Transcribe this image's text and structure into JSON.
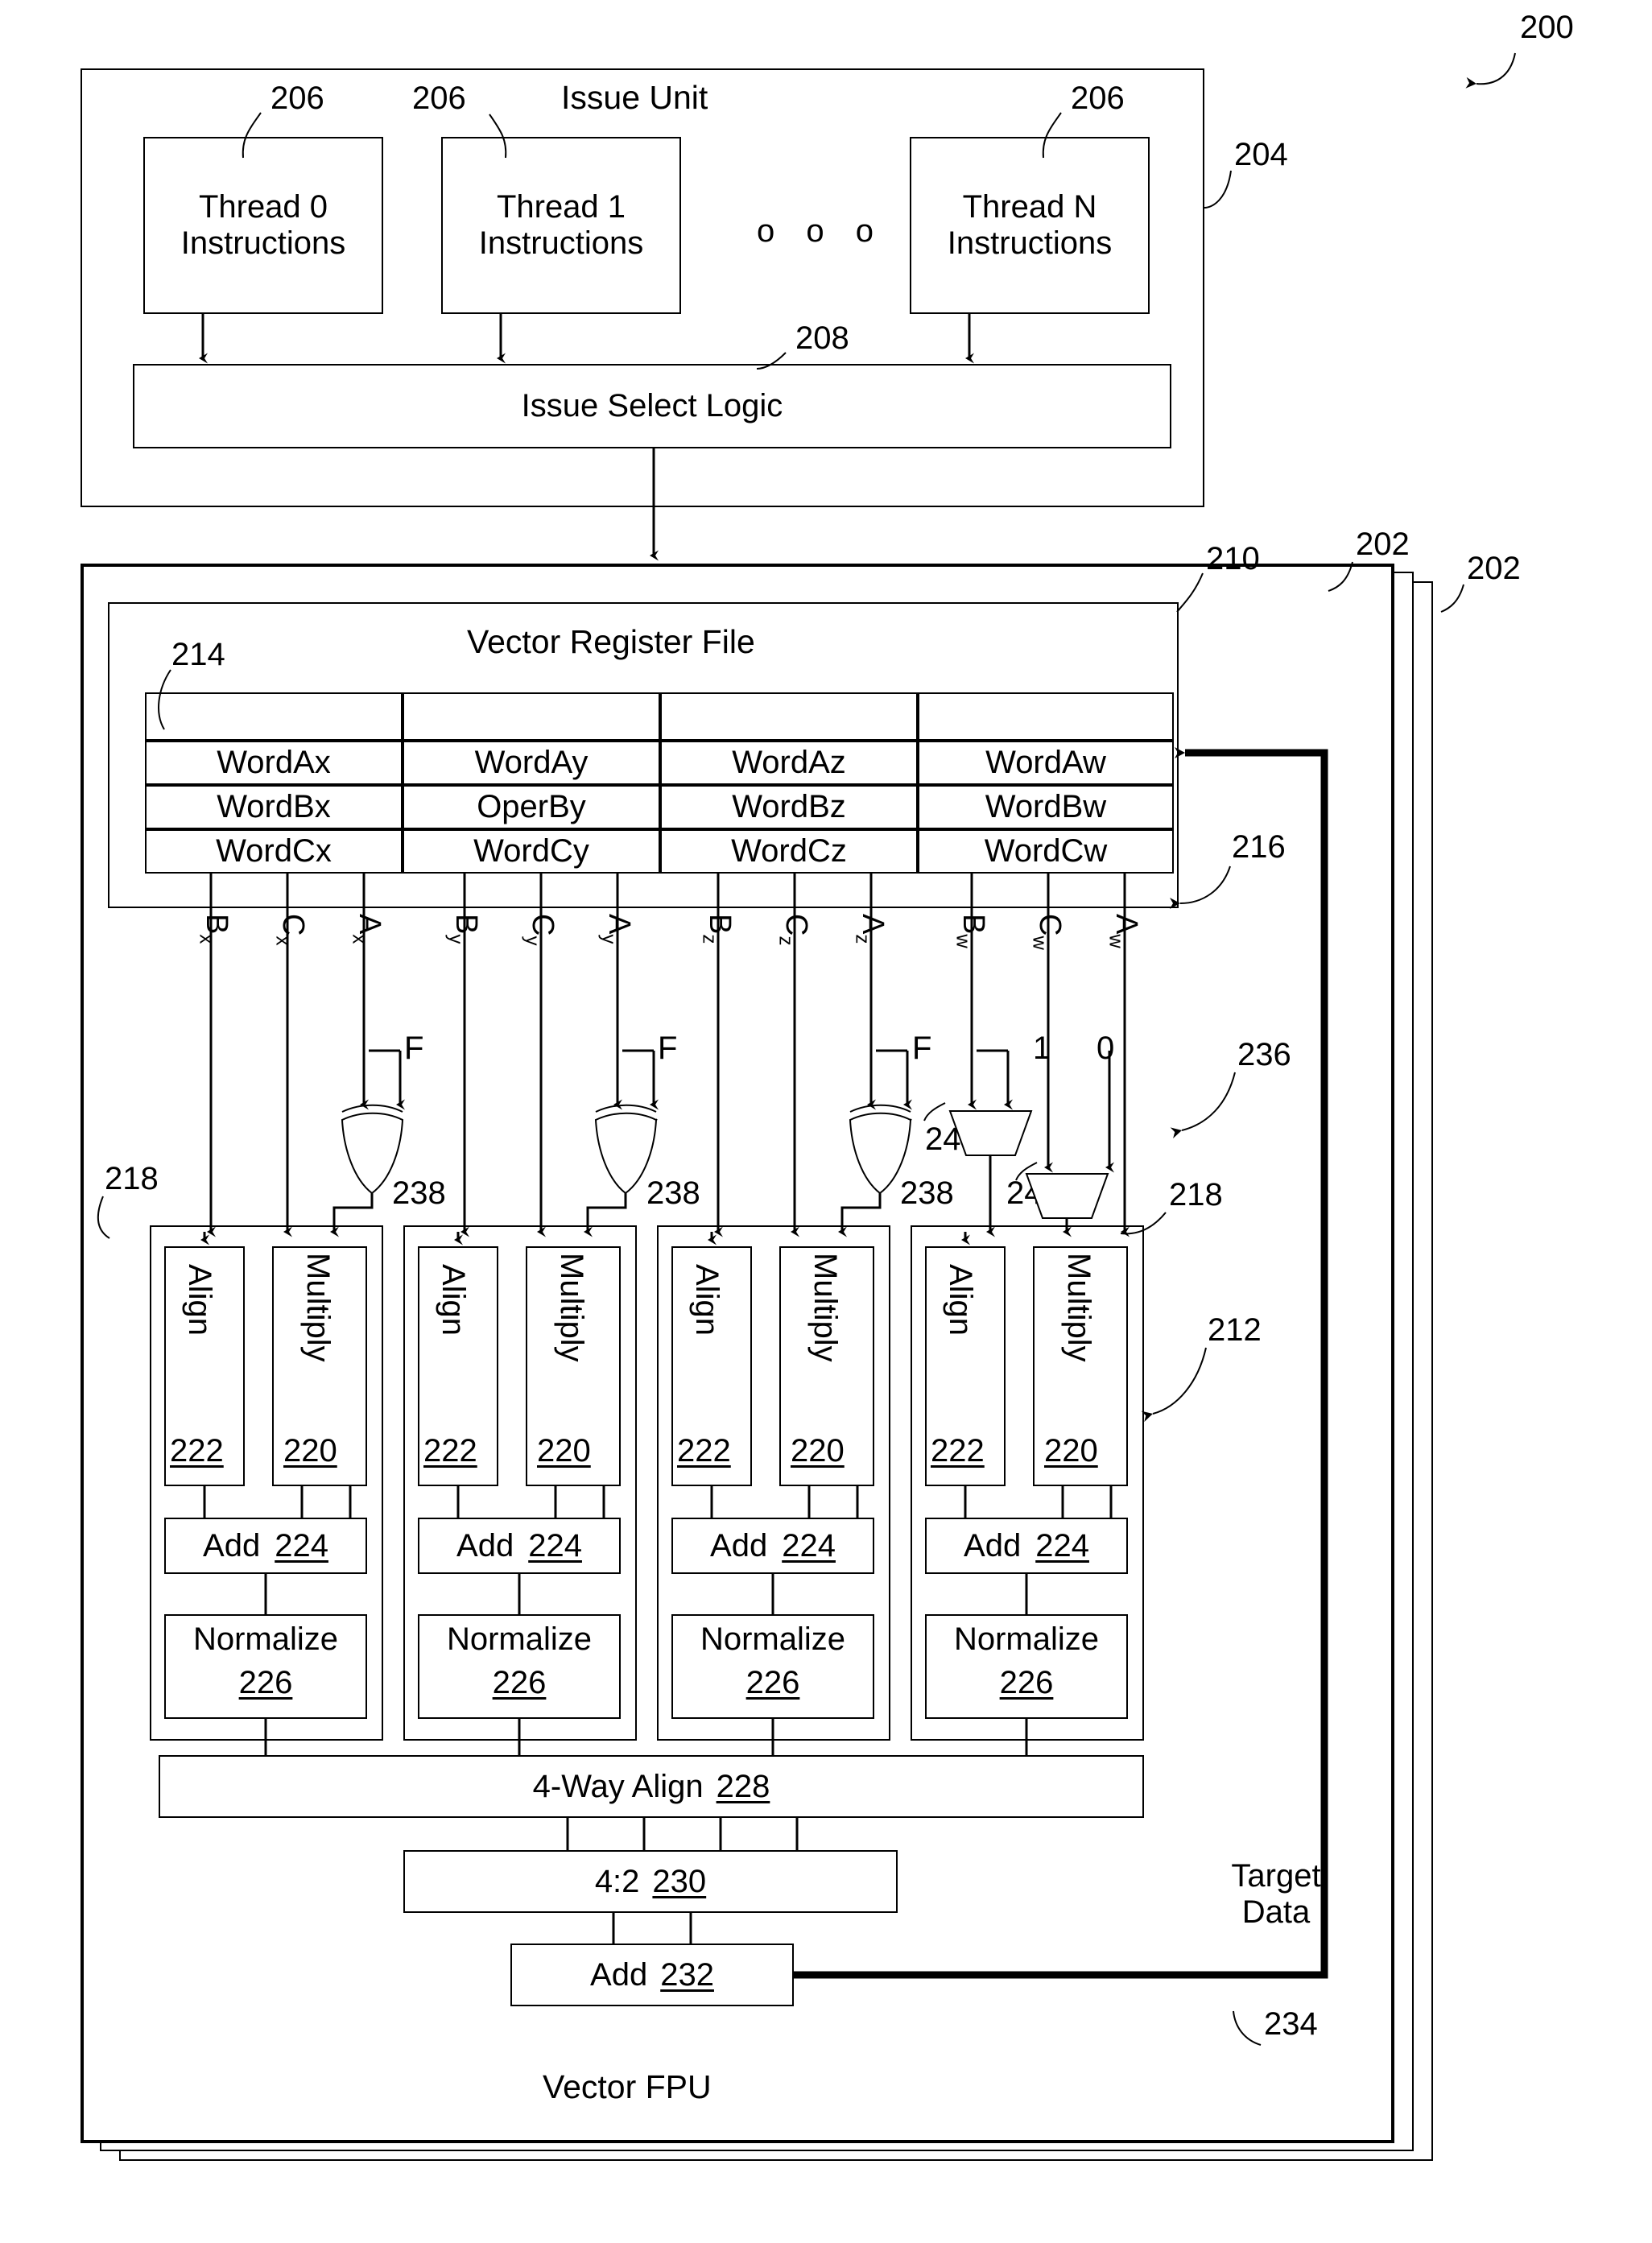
{
  "figure": {
    "number": "200",
    "issue_unit": {
      "title": "Issue Unit",
      "ref": "204",
      "thread_ref": "206",
      "threads": [
        "Thread 0\nInstructions",
        "Thread 1\nInstructions",
        "Thread N\nInstructions"
      ],
      "ellipsis": "o o o",
      "select_logic": {
        "label": "Issue Select Logic",
        "ref": "208"
      }
    },
    "vfpu": {
      "title": "Vector FPU",
      "outer_refs": [
        "202",
        "202"
      ],
      "register_file": {
        "title": "Vector Register File",
        "ref": "210",
        "table_ref": "214",
        "rows": [
          [
            "WordAx",
            "WordAy",
            "WordAz",
            "WordAw"
          ],
          [
            "WordBx",
            "OperBy",
            "WordBz",
            "WordBw"
          ],
          [
            "WordCx",
            "WordCy",
            "WordCz",
            "WordCw"
          ]
        ]
      },
      "bus_ref": "216",
      "signals": [
        {
          "base": "B",
          "sub": "x"
        },
        {
          "base": "C",
          "sub": "x"
        },
        {
          "base": "A",
          "sub": "x"
        },
        {
          "base": "B",
          "sub": "y"
        },
        {
          "base": "C",
          "sub": "y"
        },
        {
          "base": "A",
          "sub": "y"
        },
        {
          "base": "B",
          "sub": "z"
        },
        {
          "base": "C",
          "sub": "z"
        },
        {
          "base": "A",
          "sub": "z"
        },
        {
          "base": "B",
          "sub": "w"
        },
        {
          "base": "C",
          "sub": "w"
        },
        {
          "base": "A",
          "sub": "w"
        }
      ],
      "xor_inputs": [
        "F",
        "F",
        "F"
      ],
      "xor_ref": "238",
      "mux_one_input": "1",
      "mux_zero_input": "0",
      "mux_ref_240": "240",
      "mux_ref_242": "242",
      "lane_ref": "218",
      "lanes_ref": "212",
      "bracket_ref": "236",
      "lanes": [
        {
          "align": "Align",
          "align_ref": "222",
          "multiply": "Multiply",
          "multiply_ref": "220",
          "add": "Add",
          "add_ref": "224",
          "normalize": "Normalize",
          "normalize_ref": "226"
        },
        {
          "align": "Align",
          "align_ref": "222",
          "multiply": "Multiply",
          "multiply_ref": "220",
          "add": "Add",
          "add_ref": "224",
          "normalize": "Normalize",
          "normalize_ref": "226"
        },
        {
          "align": "Align",
          "align_ref": "222",
          "multiply": "Multiply",
          "multiply_ref": "220",
          "add": "Add",
          "add_ref": "224",
          "normalize": "Normalize",
          "normalize_ref": "226"
        },
        {
          "align": "Align",
          "align_ref": "222",
          "multiply": "Multiply",
          "multiply_ref": "220",
          "add": "Add",
          "add_ref": "224",
          "normalize": "Normalize",
          "normalize_ref": "226"
        }
      ],
      "align4": {
        "label": "4-Way Align",
        "ref": "228"
      },
      "csa": {
        "label": "4:2",
        "ref": "230"
      },
      "final_add": {
        "label": "Add",
        "ref": "232"
      },
      "feedback": {
        "label": "Target\nData",
        "ref": "234"
      }
    }
  },
  "colors": {
    "ink": "#000000",
    "paper": "#ffffff"
  }
}
